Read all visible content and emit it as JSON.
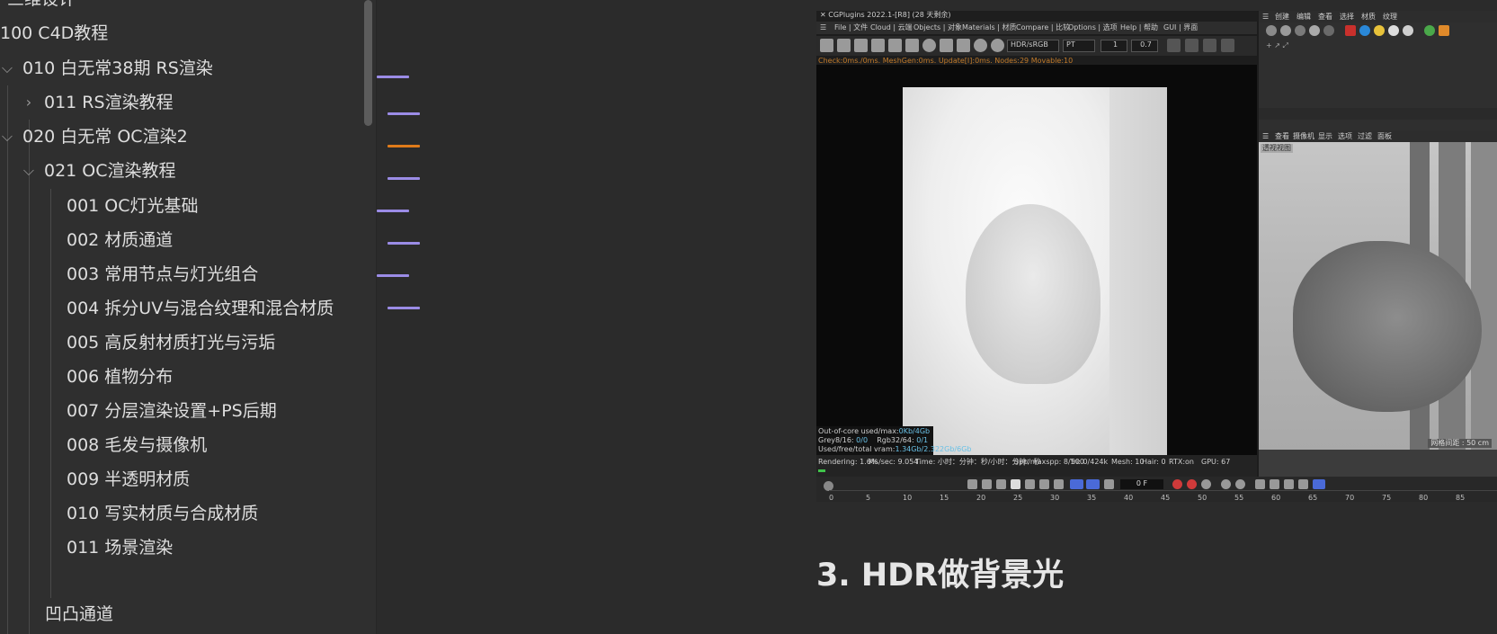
{
  "sidebar": {
    "items": [
      {
        "label": "三维设计"
      },
      {
        "label": "100  C4D教程"
      },
      {
        "label": "010  白无常38期 RS渲染"
      },
      {
        "label": "011  RS渲染教程"
      },
      {
        "label": "020 白无常 OC渲染2"
      },
      {
        "label": "021 OC渲染教程"
      },
      {
        "label": "001 OC灯光基础"
      },
      {
        "label": "002 材质通道"
      },
      {
        "label": "003 常用节点与灯光组合"
      },
      {
        "label": "004 拆分UV与混合纹理和混合材质"
      },
      {
        "label": "005 高反射材质打光与污垢"
      },
      {
        "label": "006 植物分布"
      },
      {
        "label": "007 分层渲染设置+PS后期"
      },
      {
        "label": "008 毛发与摄像机"
      },
      {
        "label": "009 半透明材质"
      },
      {
        "label": "010 写实材质与合成材质"
      },
      {
        "label": "011 场景渲染"
      },
      {
        "label": "凹凸通道"
      }
    ]
  },
  "outline_marks": {
    "colors": [
      "#9b8ce6",
      "#9b8ce6",
      "#e07b1a",
      "#9b8ce6",
      "#9b8ce6",
      "#9b8ce6",
      "#9b8ce6",
      "#9b8ce6"
    ]
  },
  "screenshot": {
    "title": "CGPlugins   2022.1-[R8] (28 天剩余)",
    "menus": [
      "File | 文件",
      "Cloud | 云端",
      "Objects | 对象",
      "Materials | 材质",
      "Compare | 比较",
      "Options | 选项",
      "Help | 帮助",
      "GUI | 界面"
    ],
    "toolbar": {
      "tonemap": "HDR/sRGB",
      "kernel": "PT",
      "value1": "1",
      "value2": "0.7"
    },
    "status_top": "Check:0ms./0ms. MeshGen:0ms. Update[I]:0ms. Nodes:29 Movable:10",
    "stats": {
      "out_of_core_label": "Out-of-core used/max:",
      "out_of_core_value": "0Kb/4Gb",
      "grey_label": "Grey8/16:",
      "grey_value": "0/0",
      "rgb_label": "Rgb32/64:",
      "rgb_value": "0/1",
      "vram_label": "Used/free/total vram:",
      "vram_value": "1.34Gb/2.322Gb/6Gb"
    },
    "render_status": {
      "rendering": "Rendering: 1.6%",
      "ms": "Ms/sec: 9.054",
      "time": "Time: 小时：分钟：秒/小时：分钟：秒",
      "spp": "Spp/maxspp: 8/500",
      "tri": "Tri: 0/424k",
      "mesh": "Mesh: 10",
      "hair": "Hair: 0",
      "rtx": "RTX:on",
      "gpu": "GPU: 67",
      "progress": 0.016
    },
    "right_menus": [
      "创建",
      "编辑",
      "查看",
      "选择",
      "材质",
      "纹理"
    ],
    "viewport_menus": [
      "查看",
      "摄像机",
      "显示",
      "选项",
      "过滤",
      "面板"
    ],
    "viewport_label": "透视视图",
    "viewport_footer": "网格间距 : 50 cm",
    "frame_field": "0 F",
    "ruler": [
      "0",
      "5",
      "10",
      "15",
      "20",
      "25",
      "30",
      "35",
      "40",
      "45",
      "50",
      "55",
      "60",
      "65",
      "70",
      "75",
      "80",
      "85"
    ]
  },
  "heading": "3. HDR做背景光"
}
